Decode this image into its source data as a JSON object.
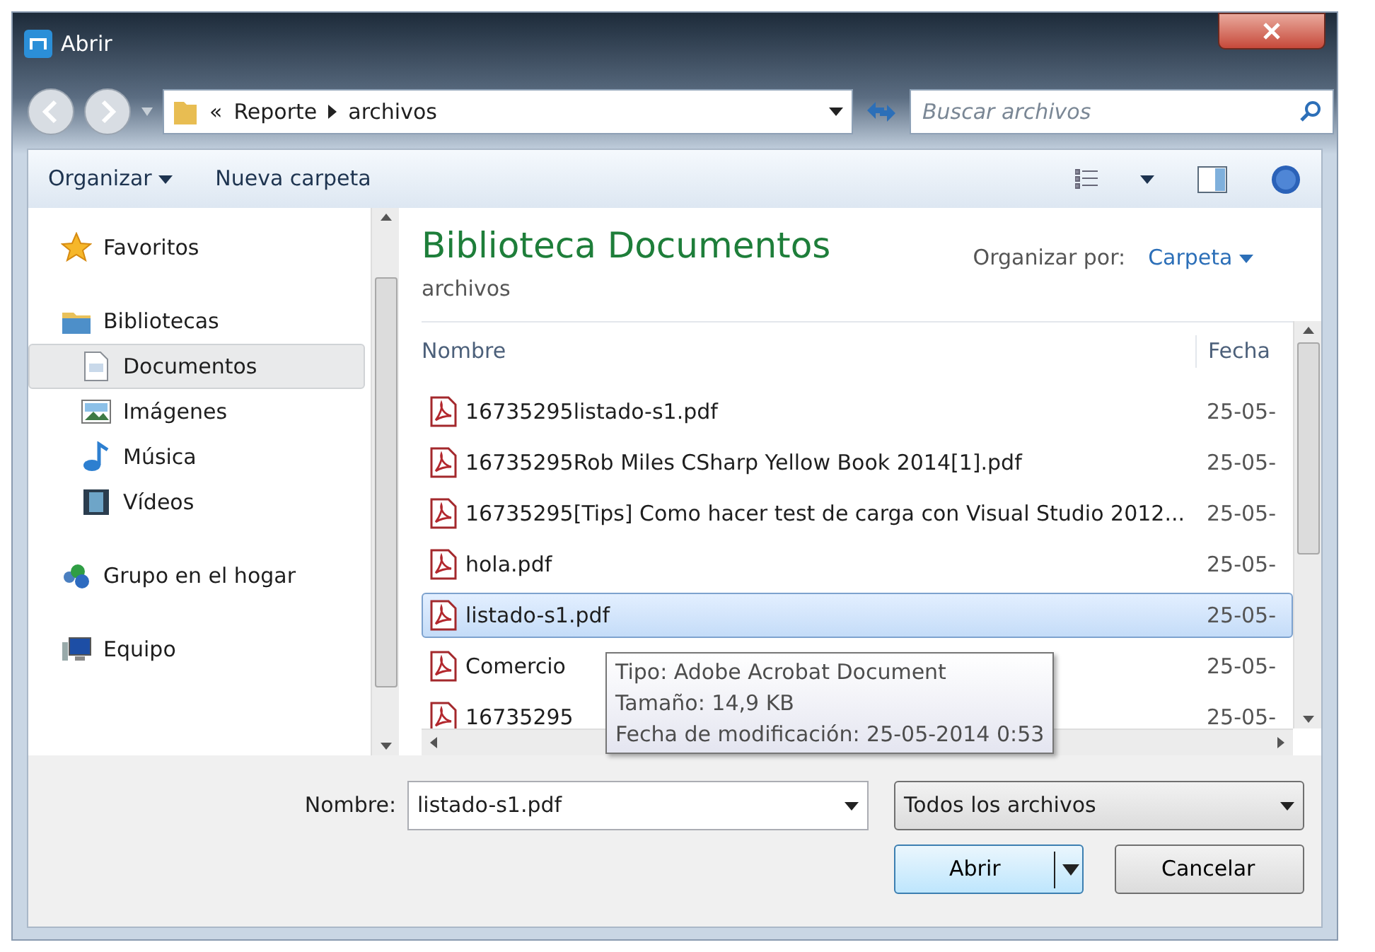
{
  "window": {
    "title": "Abrir"
  },
  "address": {
    "overflow": "«",
    "path": [
      "Reporte",
      "archivos"
    ]
  },
  "search": {
    "placeholder": "Buscar archivos"
  },
  "toolbar": {
    "organize": "Organizar",
    "new_folder": "Nueva carpeta"
  },
  "sidebar": {
    "items": [
      {
        "label": "Favoritos",
        "kind": "star",
        "selected": false
      },
      {
        "label": "Bibliotecas",
        "kind": "library",
        "selected": false,
        "children": [
          {
            "label": "Documentos",
            "kind": "document",
            "selected": true
          },
          {
            "label": "Imágenes",
            "kind": "image",
            "selected": false
          },
          {
            "label": "Música",
            "kind": "music",
            "selected": false
          },
          {
            "label": "Vídeos",
            "kind": "video",
            "selected": false
          }
        ]
      },
      {
        "label": "Grupo en el hogar",
        "kind": "homegroup",
        "selected": false
      },
      {
        "label": "Equipo",
        "kind": "computer",
        "selected": false
      }
    ]
  },
  "library": {
    "title": "Biblioteca Documentos",
    "subtitle": "archivos",
    "arrange_label": "Organizar por:",
    "arrange_value": "Carpeta"
  },
  "table": {
    "columns": [
      "Nombre",
      "Fecha"
    ],
    "rows": [
      {
        "name": "16735295listado-s1.pdf",
        "date": "25-05-",
        "selected": false
      },
      {
        "name": "16735295Rob Miles CSharp Yellow Book 2014[1].pdf",
        "date": "25-05-",
        "selected": false
      },
      {
        "name": "16735295[Tips] Como hacer test de carga con Visual Studio 2012...",
        "date": "25-05-",
        "selected": false
      },
      {
        "name": "hola.pdf",
        "date": "25-05-",
        "selected": false
      },
      {
        "name": "listado-s1.pdf",
        "date": "25-05-",
        "selected": true
      },
      {
        "name": "Comercio",
        "date": "25-05-",
        "selected": false
      },
      {
        "name": "16735295",
        "date": "25-05-",
        "selected": false
      }
    ]
  },
  "tooltip": {
    "lines": [
      "Tipo: Adobe Acrobat Document",
      "Tamaño: 14,9 KB",
      "Fecha de modificación: 25-05-2014 0:53"
    ]
  },
  "footer": {
    "name_label": "Nombre:",
    "name_value": "listado-s1.pdf",
    "filter": "Todos los archivos",
    "buttons": [
      "Abrir",
      "Cancelar"
    ]
  }
}
